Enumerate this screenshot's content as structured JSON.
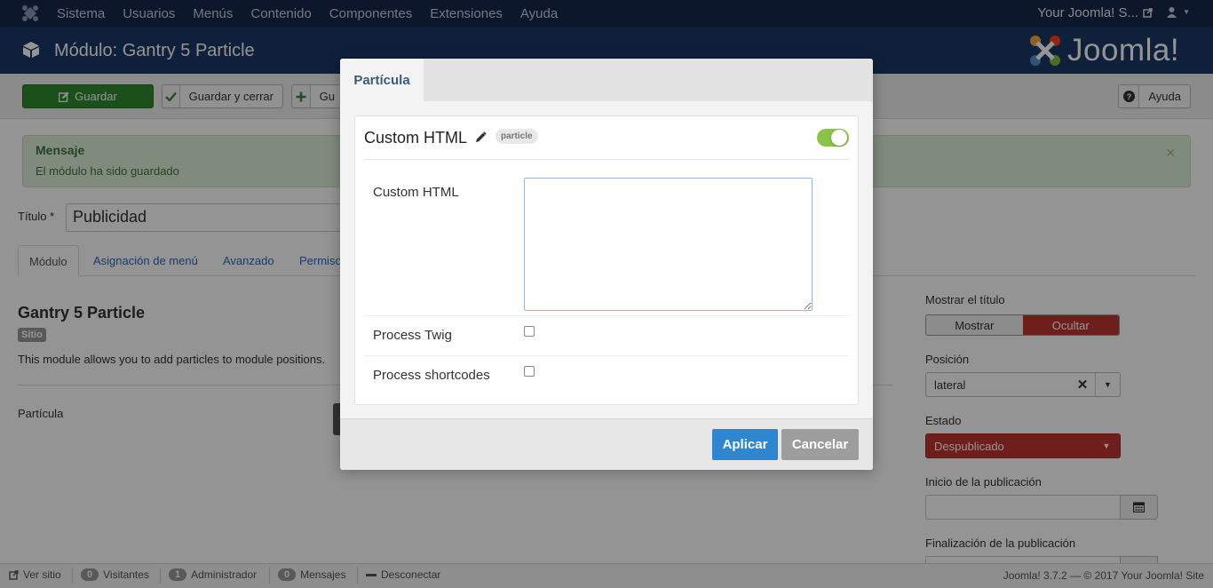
{
  "topnav": {
    "items": [
      "Sistema",
      "Usuarios",
      "Menús",
      "Contenido",
      "Componentes",
      "Extensiones",
      "Ayuda"
    ],
    "site_link": "Your Joomla! S...",
    "user_icon": "user-icon"
  },
  "header": {
    "title": "Módulo: Gantry 5 Particle",
    "brand": "Joomla!"
  },
  "toolbar": {
    "save": "Guardar",
    "save_close": "Guardar y cerrar",
    "save_new_partial": "Gu",
    "help": "Ayuda"
  },
  "alert": {
    "heading": "Mensaje",
    "text": "El módulo ha sido guardado",
    "close": "×"
  },
  "form": {
    "title_label": "Título *",
    "title_value": "Publicidad",
    "tabs": [
      "Módulo",
      "Asignación de menú",
      "Avanzado",
      "Permiso"
    ],
    "module_name": "Gantry 5 Particle",
    "site_badge": "Sitio",
    "description": "This module allows you to add particles to module positions.",
    "particle_label": "Partícula"
  },
  "sidebar": {
    "show_title_label": "Mostrar el título",
    "show": "Mostrar",
    "hide": "Ocultar",
    "position_label": "Posición",
    "position_value": "lateral",
    "state_label": "Estado",
    "state_value": "Despublicado",
    "publish_start_label": "Inicio de la publicación",
    "publish_end_label": "Finalización de la publicación"
  },
  "statusbar": {
    "view_site": "Ver sitio",
    "visitors_count": "0",
    "visitors": "Visitantes",
    "admin_count": "1",
    "admin": "Administrador",
    "messages_count": "0",
    "messages": "Mensajes",
    "logout": "Desconectar",
    "copyright": "Joomla! 3.7.2  —  © 2017 Your Joomla! Site"
  },
  "modal": {
    "tab": "Partícula",
    "card_title": "Custom HTML",
    "badge": "particle",
    "toggle_on": true,
    "field_html_label": "Custom HTML",
    "field_html_value": "",
    "field_twig_label": "Process Twig",
    "field_shortcodes_label": "Process shortcodes",
    "apply": "Aplicar",
    "cancel": "Cancelar"
  },
  "colors": {
    "topnav_bg": "#17294a",
    "header_bg": "#1a3867",
    "save_green": "#2f8a2f",
    "danger_red": "#bd362f",
    "apply_blue": "#2e86d0",
    "toggle_green": "#8bc34a"
  }
}
